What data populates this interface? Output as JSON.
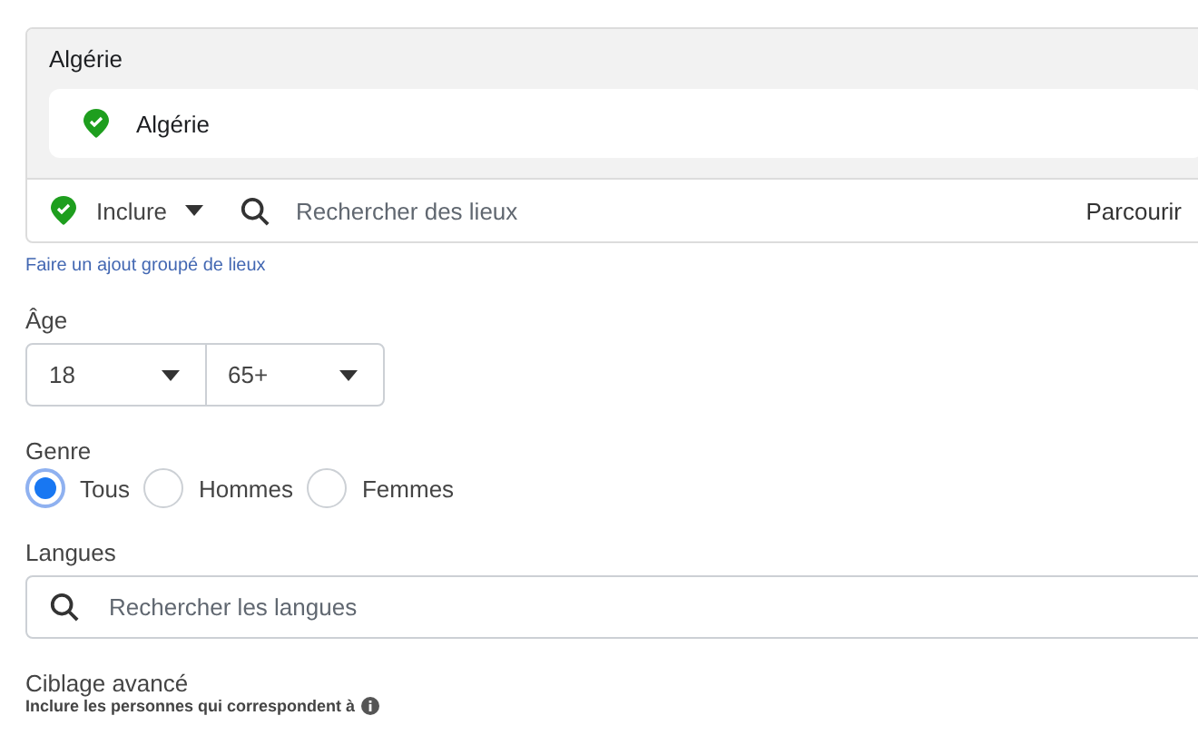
{
  "locations": {
    "group_title": "Algérie",
    "items": [
      {
        "name": "Algérie"
      }
    ],
    "mode": "Inclure",
    "search": {
      "placeholder": "Rechercher des lieux"
    },
    "browse": "Parcourir"
  },
  "bulk_link": "Faire un ajout groupé de lieux",
  "age": {
    "label": "Âge",
    "min": "18",
    "max": "65+"
  },
  "gender": {
    "label": "Genre",
    "options": [
      {
        "label": "Tous",
        "selected": true
      },
      {
        "label": "Hommes",
        "selected": false
      },
      {
        "label": "Femmes",
        "selected": false
      }
    ]
  },
  "languages": {
    "label": "Langues",
    "search": {
      "placeholder": "Rechercher les langues"
    }
  },
  "advanced": {
    "title": "Ciblage avancé",
    "subtitle": "Inclure les personnes qui correspondent à"
  }
}
